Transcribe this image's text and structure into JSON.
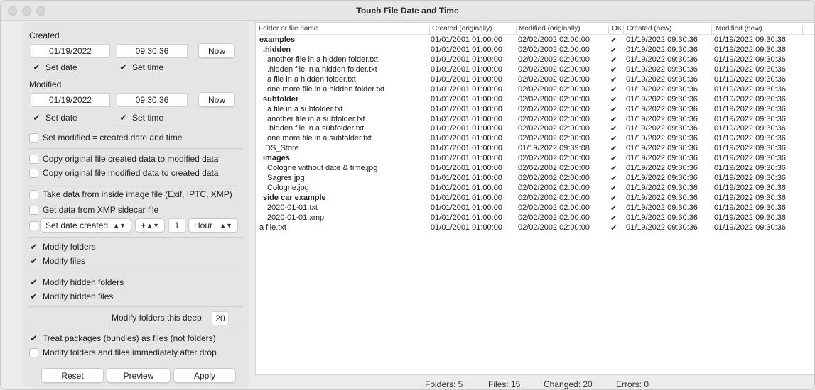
{
  "window": {
    "title": "Touch File Date and Time"
  },
  "created": {
    "label": "Created",
    "date": "01/19/2022",
    "time": "09:30:36",
    "now_label": "Now",
    "set_date_label": "Set date",
    "set_time_label": "Set time"
  },
  "modified": {
    "label": "Modified",
    "date": "01/19/2022",
    "time": "09:30:36",
    "now_label": "Now",
    "set_date_label": "Set date",
    "set_time_label": "Set time"
  },
  "options": {
    "set_modified_equal": "Set modified = created date and time",
    "copy_created_to_modified": "Copy original file created data to modified data",
    "copy_modified_to_created": "Copy original file modified data to created data",
    "from_image": "Take data from inside image file (Exif, IPTC, XMP)",
    "from_xmp": "Get data from XMP sidecar file",
    "shift_field": "Set date created",
    "shift_op": "+",
    "shift_amount": "1",
    "shift_unit": "Hour",
    "modify_folders": "Modify folders",
    "modify_files": "Modify files",
    "modify_hidden_folders": "Modify hidden folders",
    "modify_hidden_files": "Modify hidden files",
    "depth_label": "Modify folders this deep:",
    "depth_value": "20",
    "treat_packages": "Treat packages (bundles) as files (not folders)",
    "modify_immediately": "Modify folders and files immediately after drop"
  },
  "buttons": {
    "reset": "Reset",
    "preview": "Preview",
    "apply": "Apply"
  },
  "table": {
    "columns": [
      "Folder or file name",
      "Created (originally)",
      "Modified (originally)",
      "OK",
      "Created (new)",
      "Modified (new)"
    ],
    "rows": [
      {
        "name": "examples",
        "indent": 0,
        "bold": true,
        "c": "01/01/2001  01:00:00",
        "m": "02/02/2002  02:00:00",
        "ok": "✔",
        "cn": "01/19/2022  09:30:36",
        "mn": "01/19/2022  09:30:36"
      },
      {
        "name": ".hidden",
        "indent": 1,
        "bold": true,
        "c": "01/01/2001  01:00:00",
        "m": "02/02/2002  02:00:00",
        "ok": "✔",
        "cn": "01/19/2022  09:30:36",
        "mn": "01/19/2022  09:30:36"
      },
      {
        "name": "another file in a hidden folder.txt",
        "indent": 2,
        "bold": false,
        "c": "01/01/2001  01:00:00",
        "m": "02/02/2002  02:00:00",
        "ok": "✔",
        "cn": "01/19/2022  09:30:36",
        "mn": "01/19/2022  09:30:36"
      },
      {
        "name": ".hidden file in a hidden folder.txt",
        "indent": 2,
        "bold": false,
        "c": "01/01/2001  01:00:00",
        "m": "02/02/2002  02:00:00",
        "ok": "✔",
        "cn": "01/19/2022  09:30:36",
        "mn": "01/19/2022  09:30:36"
      },
      {
        "name": "a file in a hidden folder.txt",
        "indent": 2,
        "bold": false,
        "c": "01/01/2001  01:00:00",
        "m": "02/02/2002  02:00:00",
        "ok": "✔",
        "cn": "01/19/2022  09:30:36",
        "mn": "01/19/2022  09:30:36"
      },
      {
        "name": "one more file in a hidden folder.txt",
        "indent": 2,
        "bold": false,
        "c": "01/01/2001  01:00:00",
        "m": "02/02/2002  02:00:00",
        "ok": "✔",
        "cn": "01/19/2022  09:30:36",
        "mn": "01/19/2022  09:30:36"
      },
      {
        "name": "subfolder",
        "indent": 1,
        "bold": true,
        "c": "01/01/2001  01:00:00",
        "m": "02/02/2002  02:00:00",
        "ok": "✔",
        "cn": "01/19/2022  09:30:36",
        "mn": "01/19/2022  09:30:36"
      },
      {
        "name": "a file in a subfolder.txt",
        "indent": 2,
        "bold": false,
        "c": "01/01/2001  01:00:00",
        "m": "02/02/2002  02:00:00",
        "ok": "✔",
        "cn": "01/19/2022  09:30:36",
        "mn": "01/19/2022  09:30:36"
      },
      {
        "name": "another file in a subfolder.txt",
        "indent": 2,
        "bold": false,
        "c": "01/01/2001  01:00:00",
        "m": "02/02/2002  02:00:00",
        "ok": "✔",
        "cn": "01/19/2022  09:30:36",
        "mn": "01/19/2022  09:30:36"
      },
      {
        "name": ".hidden file in a subfolder.txt",
        "indent": 2,
        "bold": false,
        "c": "01/01/2001  01:00:00",
        "m": "02/02/2002  02:00:00",
        "ok": "✔",
        "cn": "01/19/2022  09:30:36",
        "mn": "01/19/2022  09:30:36"
      },
      {
        "name": "one more file in a subfolder.txt",
        "indent": 2,
        "bold": false,
        "c": "01/01/2001  01:00:00",
        "m": "02/02/2002  02:00:00",
        "ok": "✔",
        "cn": "01/19/2022  09:30:36",
        "mn": "01/19/2022  09:30:36"
      },
      {
        "name": ".DS_Store",
        "indent": 1,
        "bold": false,
        "c": "01/01/2001  01:00:00",
        "m": "01/19/2022  09:39:08",
        "ok": "✔",
        "cn": "01/19/2022  09:30:36",
        "mn": "01/19/2022  09:30:36"
      },
      {
        "name": "images",
        "indent": 1,
        "bold": true,
        "c": "01/01/2001  01:00:00",
        "m": "02/02/2002  02:00:00",
        "ok": "✔",
        "cn": "01/19/2022  09:30:36",
        "mn": "01/19/2022  09:30:36"
      },
      {
        "name": "Cologne without date & time.jpg",
        "indent": 2,
        "bold": false,
        "c": "01/01/2001  01:00:00",
        "m": "02/02/2002  02:00:00",
        "ok": "✔",
        "cn": "01/19/2022  09:30:36",
        "mn": "01/19/2022  09:30:36"
      },
      {
        "name": "Sagres.jpg",
        "indent": 2,
        "bold": false,
        "c": "01/01/2001  01:00:00",
        "m": "02/02/2002  02:00:00",
        "ok": "✔",
        "cn": "01/19/2022  09:30:36",
        "mn": "01/19/2022  09:30:36"
      },
      {
        "name": "Cologne.jpg",
        "indent": 2,
        "bold": false,
        "c": "01/01/2001  01:00:00",
        "m": "02/02/2002  02:00:00",
        "ok": "✔",
        "cn": "01/19/2022  09:30:36",
        "mn": "01/19/2022  09:30:36"
      },
      {
        "name": "side car example",
        "indent": 1,
        "bold": true,
        "c": "01/01/2001  01:00:00",
        "m": "02/02/2002  02:00:00",
        "ok": "✔",
        "cn": "01/19/2022  09:30:36",
        "mn": "01/19/2022  09:30:36"
      },
      {
        "name": "2020-01-01.txt",
        "indent": 2,
        "bold": false,
        "c": "01/01/2001  01:00:00",
        "m": "02/02/2002  02:00:00",
        "ok": "✔",
        "cn": "01/19/2022  09:30:36",
        "mn": "01/19/2022  09:30:36"
      },
      {
        "name": "2020-01-01.xmp",
        "indent": 2,
        "bold": false,
        "c": "01/01/2001  01:00:00",
        "m": "02/02/2002  02:00:00",
        "ok": "✔",
        "cn": "01/19/2022  09:30:36",
        "mn": "01/19/2022  09:30:36"
      },
      {
        "name": "a file.txt",
        "indent": 0,
        "bold": false,
        "c": "01/01/2001  01:00:00",
        "m": "02/02/2002  02:00:00",
        "ok": "✔",
        "cn": "01/19/2022  09:30:36",
        "mn": "01/19/2022  09:30:36"
      }
    ]
  },
  "status": {
    "folders": "Folders: 5",
    "files": "Files: 15",
    "changed": "Changed: 20",
    "errors": "Errors: 0"
  }
}
